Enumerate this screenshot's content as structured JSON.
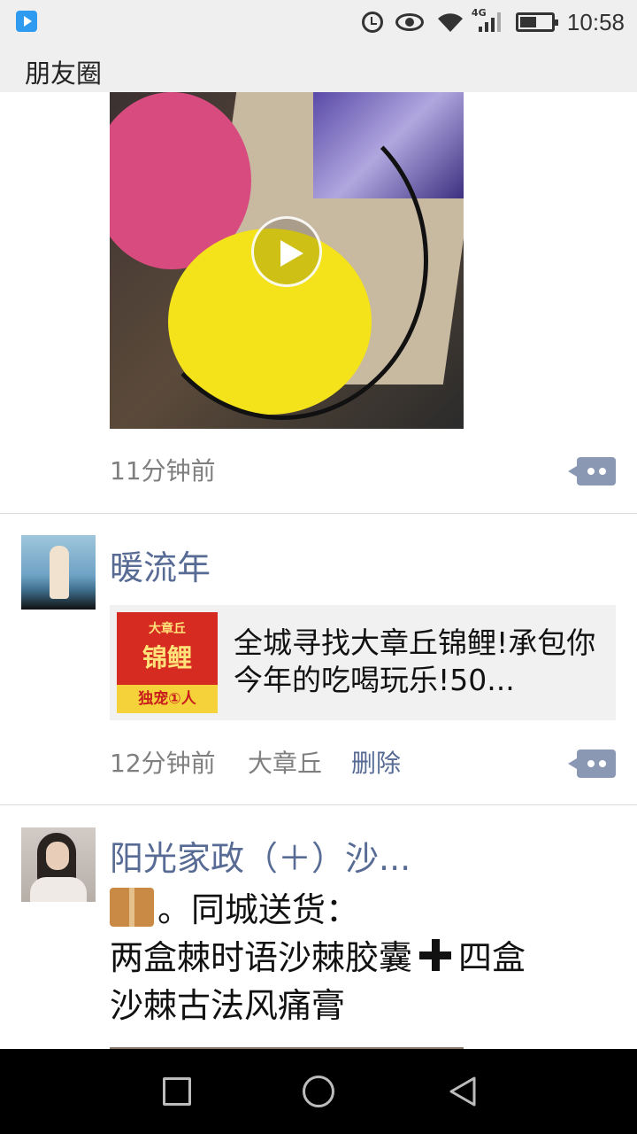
{
  "status_bar": {
    "time": "10:58",
    "network_label": "4G",
    "icons": [
      "app-icon",
      "alarm-icon",
      "eye-icon",
      "wifi-icon",
      "signal-icon",
      "battery-icon"
    ]
  },
  "header": {
    "title": "朋友圈"
  },
  "posts": [
    {
      "media": "video-thumbnail",
      "time": "11分钟前"
    },
    {
      "author": "暖流年",
      "link": {
        "thumb_top": "大章丘",
        "thumb_main": "锦鲤",
        "thumb_bottom": "独宠①人",
        "title": "全城寻找大章丘锦鲤!承包你今年的吃喝玩乐!50..."
      },
      "time": "12分钟前",
      "location": "大章丘",
      "delete_label": "删除"
    },
    {
      "author": "阳光家政（＋）沙...",
      "text_line1": "。同城送货：",
      "text_line2a": "两盒棘时语沙棘胶囊",
      "text_line2b": "四盒",
      "text_line3": "沙棘古法风痛膏"
    }
  ],
  "nav": {
    "icons": [
      "recent-apps-icon",
      "home-icon",
      "back-icon"
    ]
  }
}
